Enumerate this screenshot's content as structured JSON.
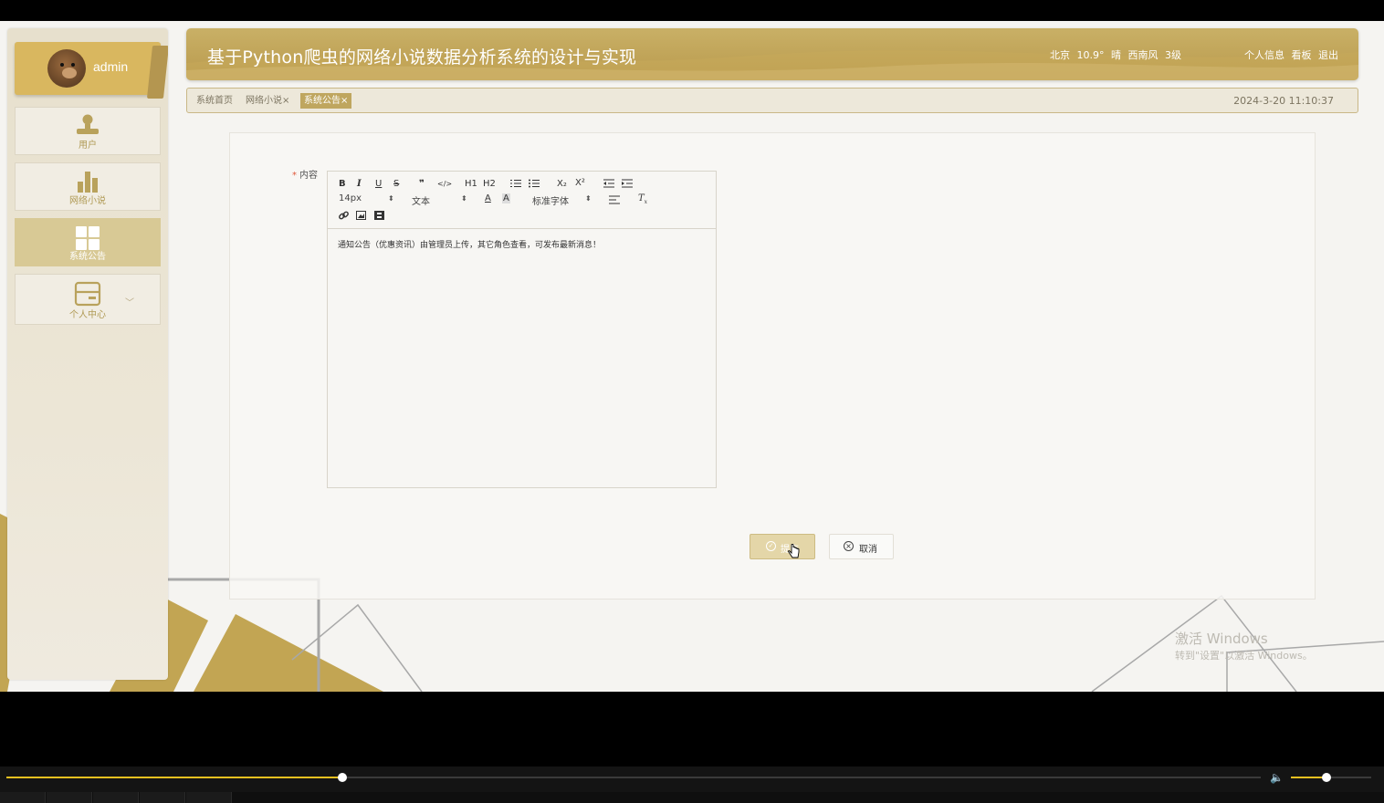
{
  "app": {
    "title": "基于Python爬虫的网络小说数据分析系统的设计与实现",
    "accent_color": "#c0a456"
  },
  "user": {
    "name": "admin",
    "avatar": "bear-avatar"
  },
  "weather": {
    "city": "北京",
    "temp": "10.9°",
    "condition": "晴",
    "wind": "西南风",
    "level": "3级"
  },
  "header_nav": {
    "profile": "个人信息",
    "dashboard": "看板",
    "logout": "退出"
  },
  "sidebar": {
    "items": [
      {
        "label": "用户",
        "icon": "user-icon",
        "active": false
      },
      {
        "label": "网络小说",
        "icon": "bar-chart-icon",
        "active": false
      },
      {
        "label": "系统公告",
        "icon": "grid-icon",
        "active": true
      },
      {
        "label": "个人中心",
        "icon": "card-icon",
        "active": false,
        "expandable": true
      }
    ]
  },
  "tabs": [
    {
      "label": "系统首页",
      "closable": false,
      "active": false
    },
    {
      "label": "网络小说",
      "closable": true,
      "active": false
    },
    {
      "label": "系统公告",
      "closable": true,
      "active": true
    }
  ],
  "tab_close_glyph": "×",
  "datetime": "2024-3-20 11:10:37",
  "form": {
    "content_label": "内容",
    "required_mark": "*",
    "editor": {
      "toolbar_row1": [
        "B",
        "I",
        "U",
        "S",
        "❞",
        "</>",
        "H1",
        "H2",
        "ordered-list-icon",
        "bullet-list-icon",
        "X₂",
        "X²",
        "outdent-icon",
        "indent-icon"
      ],
      "font_size": "14px",
      "text_style": "文本",
      "font_family": "标准字体",
      "toolbar_row3": [
        "link-icon",
        "image-icon",
        "video-icon"
      ],
      "content": "通知公告（优惠资讯）由管理员上传，其它角色查看，可发布最新消息！"
    },
    "submit_label": "提交",
    "cancel_label": "取消"
  },
  "watermark": {
    "line1": "激活 Windows",
    "line2": "转到\"设置\"以激活 Windows。"
  },
  "player": {
    "progress": 0.268,
    "volume": 0.44
  }
}
